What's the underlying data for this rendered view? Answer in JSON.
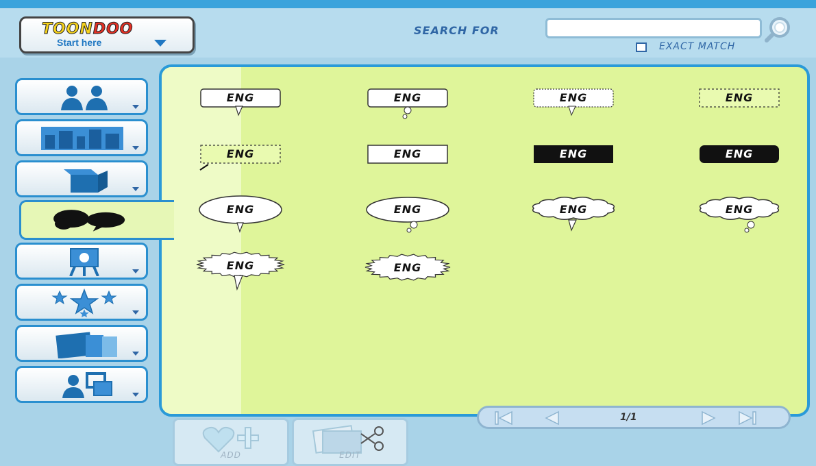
{
  "app": {
    "logo_text_a": "TOON",
    "logo_text_b": "DOO",
    "start_label": "Start here"
  },
  "search": {
    "label": "SEARCH FOR",
    "value": "",
    "placeholder": "",
    "exact_match_label": "EXACT MATCH",
    "exact_match_checked": false
  },
  "sidebar": {
    "tabs": [
      {
        "name": "characters",
        "icon": "characters-icon",
        "active": false
      },
      {
        "name": "backgrounds",
        "icon": "backgrounds-icon",
        "active": false
      },
      {
        "name": "props",
        "icon": "box-icon",
        "active": false
      },
      {
        "name": "speech-bubbles",
        "icon": "speech-bubbles-icon",
        "active": true
      },
      {
        "name": "text",
        "icon": "easel-icon",
        "active": false
      },
      {
        "name": "special-effects",
        "icon": "stars-icon",
        "active": false
      },
      {
        "name": "images",
        "icon": "photos-icon",
        "active": false
      },
      {
        "name": "my-characters",
        "icon": "character-frame-icon",
        "active": false
      }
    ]
  },
  "bubbles": {
    "items": [
      {
        "text": "ENG",
        "style": "rect-speech"
      },
      {
        "text": "ENG",
        "style": "rect-thought"
      },
      {
        "text": "ENG",
        "style": "rect-dotted-speech"
      },
      {
        "text": "ENG",
        "style": "rect-dashed"
      },
      {
        "text": "ENG",
        "style": "rect-dashed-tail"
      },
      {
        "text": "ENG",
        "style": "rect-caption"
      },
      {
        "text": "ENG",
        "style": "rect-black"
      },
      {
        "text": "ENG",
        "style": "rect-black-rounded"
      },
      {
        "text": "ENG",
        "style": "oval-speech"
      },
      {
        "text": "ENG",
        "style": "oval-thought"
      },
      {
        "text": "ENG",
        "style": "cloud-speech"
      },
      {
        "text": "ENG",
        "style": "cloud-thought"
      },
      {
        "text": "ENG",
        "style": "burst-speech"
      },
      {
        "text": "ENG",
        "style": "burst"
      }
    ]
  },
  "pager": {
    "page": "1/1"
  },
  "actions": {
    "add_label": "ADD",
    "edit_label": "EDIT"
  },
  "colors": {
    "accent": "#2a9ad8",
    "panel": "#dff59a",
    "header": "#b7dcee",
    "page_bg": "#a9d3e8"
  }
}
